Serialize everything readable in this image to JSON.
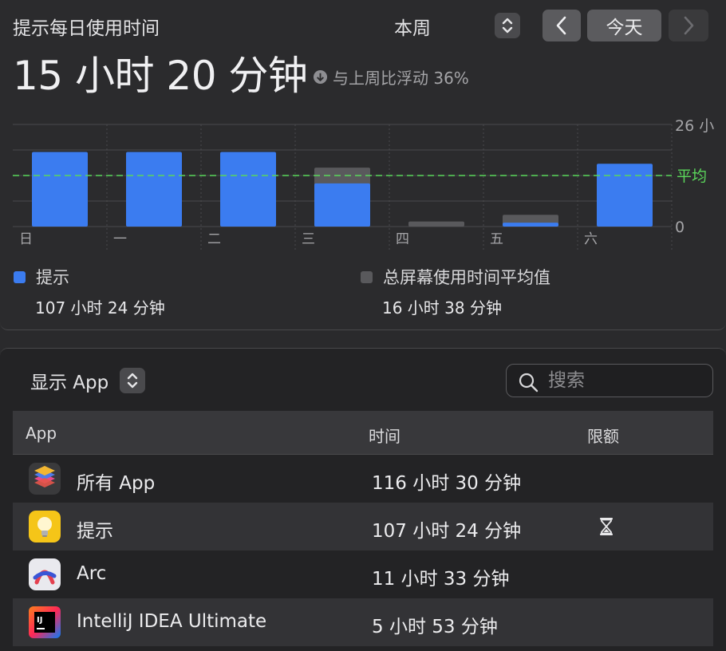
{
  "header": {
    "title": "提示每日使用时间",
    "period": "本周",
    "today_button": "今天",
    "total": "15 小时 20 分钟",
    "delta": "与上周比浮动 36%",
    "icons": {
      "period_stepper": "up-down-chevron-icon",
      "prev": "chevron-left-icon",
      "next": "chevron-right-icon",
      "delta": "arrow-down-circle-icon"
    }
  },
  "chart_data": {
    "type": "bar",
    "categories": [
      "日",
      "一",
      "二",
      "三",
      "四",
      "五",
      "六"
    ],
    "series": [
      {
        "name": "提示",
        "color": "#3b7cf0",
        "values": [
          19,
          19,
          19,
          11,
          0,
          1,
          16
        ]
      },
      {
        "name": "总屏幕使用时间平均值",
        "color": "#59595c",
        "values": [
          19,
          19,
          19,
          15,
          1.3,
          3,
          16
        ]
      }
    ],
    "average": 13,
    "average_label": "平均",
    "average_color": "#5bd75b",
    "ylim": [
      0,
      26
    ],
    "tick_labels": {
      "top": "26 小",
      "bottom": "0"
    }
  },
  "legend": {
    "items": [
      {
        "label": "提示",
        "value": "107 小时 24 分钟",
        "color": "#3b7cf0"
      },
      {
        "label": "总屏幕使用时间平均值",
        "value": "16 小时 38 分钟",
        "color": "#59595c"
      }
    ]
  },
  "list": {
    "show_label": "显示 App",
    "search_placeholder": "搜索",
    "columns": [
      "App",
      "时间",
      "限额"
    ],
    "rows": [
      {
        "name": "所有 App",
        "time": "116 小时 30 分钟",
        "icon": "stacked-layers-icon",
        "limit": false
      },
      {
        "name": "提示",
        "time": "107 小时 24 分钟",
        "icon": "tips-lightbulb-icon",
        "limit": true
      },
      {
        "name": "Arc",
        "time": "11 小时 33 分钟",
        "icon": "arc-browser-icon",
        "limit": false
      },
      {
        "name": "IntelliJ IDEA Ultimate",
        "time": "5 小时 53 分钟",
        "icon": "intellij-idea-icon",
        "limit": false
      }
    ],
    "limit_icon": "hourglass-icon"
  }
}
